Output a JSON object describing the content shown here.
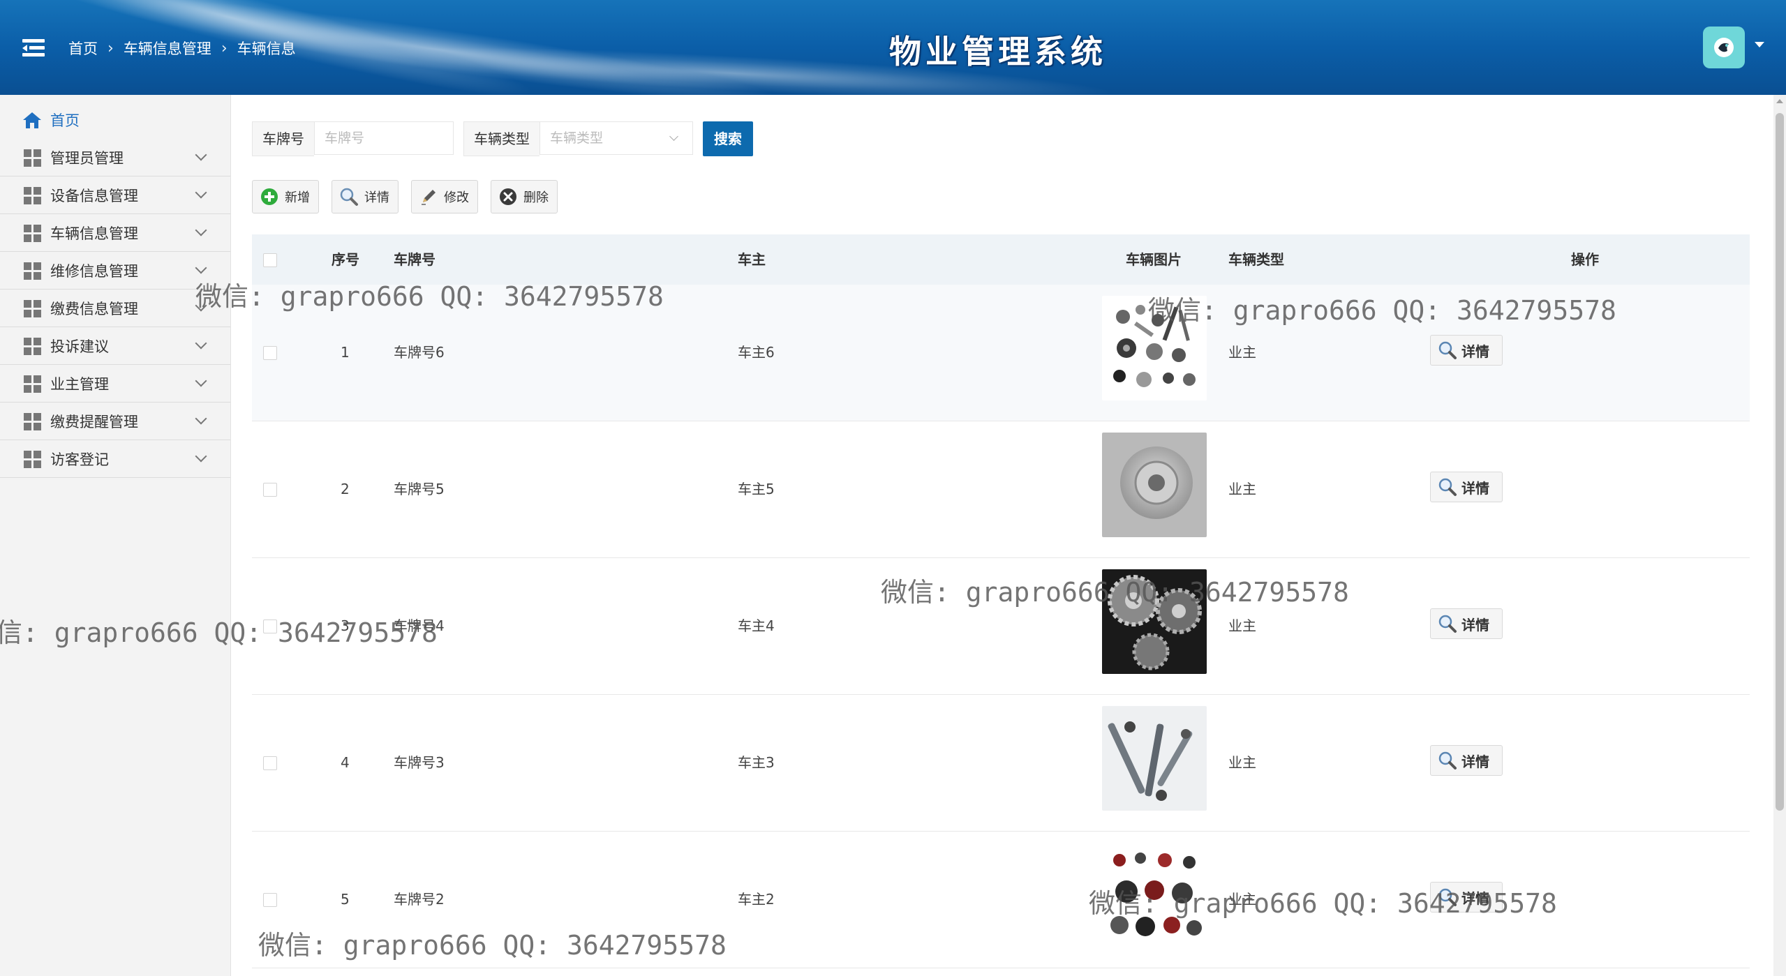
{
  "header": {
    "app_title": "物业管理系统",
    "breadcrumb": [
      "首页",
      "车辆信息管理",
      "车辆信息"
    ]
  },
  "sidebar": {
    "items": [
      {
        "label": "首页",
        "icon": "home-icon"
      },
      {
        "label": "管理员管理",
        "icon": "grid-icon"
      },
      {
        "label": "设备信息管理",
        "icon": "grid-icon"
      },
      {
        "label": "车辆信息管理",
        "icon": "grid-icon"
      },
      {
        "label": "维修信息管理",
        "icon": "grid-icon"
      },
      {
        "label": "缴费信息管理",
        "icon": "grid-icon"
      },
      {
        "label": "投诉建议",
        "icon": "grid-icon"
      },
      {
        "label": "业主管理",
        "icon": "grid-icon"
      },
      {
        "label": "缴费提醒管理",
        "icon": "grid-icon"
      },
      {
        "label": "访客登记",
        "icon": "grid-icon"
      }
    ]
  },
  "search": {
    "plate_label": "车牌号",
    "plate_placeholder": "车牌号",
    "type_label": "车辆类型",
    "type_placeholder": "车辆类型",
    "button": "搜索"
  },
  "toolbar": {
    "add": "新增",
    "detail": "详情",
    "edit": "修改",
    "delete": "删除"
  },
  "table": {
    "headers": {
      "index": "序号",
      "plate": "车牌号",
      "owner": "车主",
      "image": "车辆图片",
      "type": "车辆类型",
      "actions": "操作"
    },
    "rows": [
      {
        "index": "1",
        "plate": "车牌号6",
        "owner": "车主6",
        "type": "业主",
        "action": "详情"
      },
      {
        "index": "2",
        "plate": "车牌号5",
        "owner": "车主5",
        "type": "业主",
        "action": "详情"
      },
      {
        "index": "3",
        "plate": "车牌号4",
        "owner": "车主4",
        "type": "业主",
        "action": "详情"
      },
      {
        "index": "4",
        "plate": "车牌号3",
        "owner": "车主3",
        "type": "业主",
        "action": "详情"
      },
      {
        "index": "5",
        "plate": "车牌号2",
        "owner": "车主2",
        "type": "业主",
        "action": "详情"
      }
    ]
  },
  "watermark": "微信: grapro666 QQ: 3642795578",
  "colors": {
    "header_blue": "#0b5ea8",
    "search_button": "#0d6aae",
    "active_nav": "#1f6fc0",
    "avatar_bg": "#6fd7d9"
  }
}
